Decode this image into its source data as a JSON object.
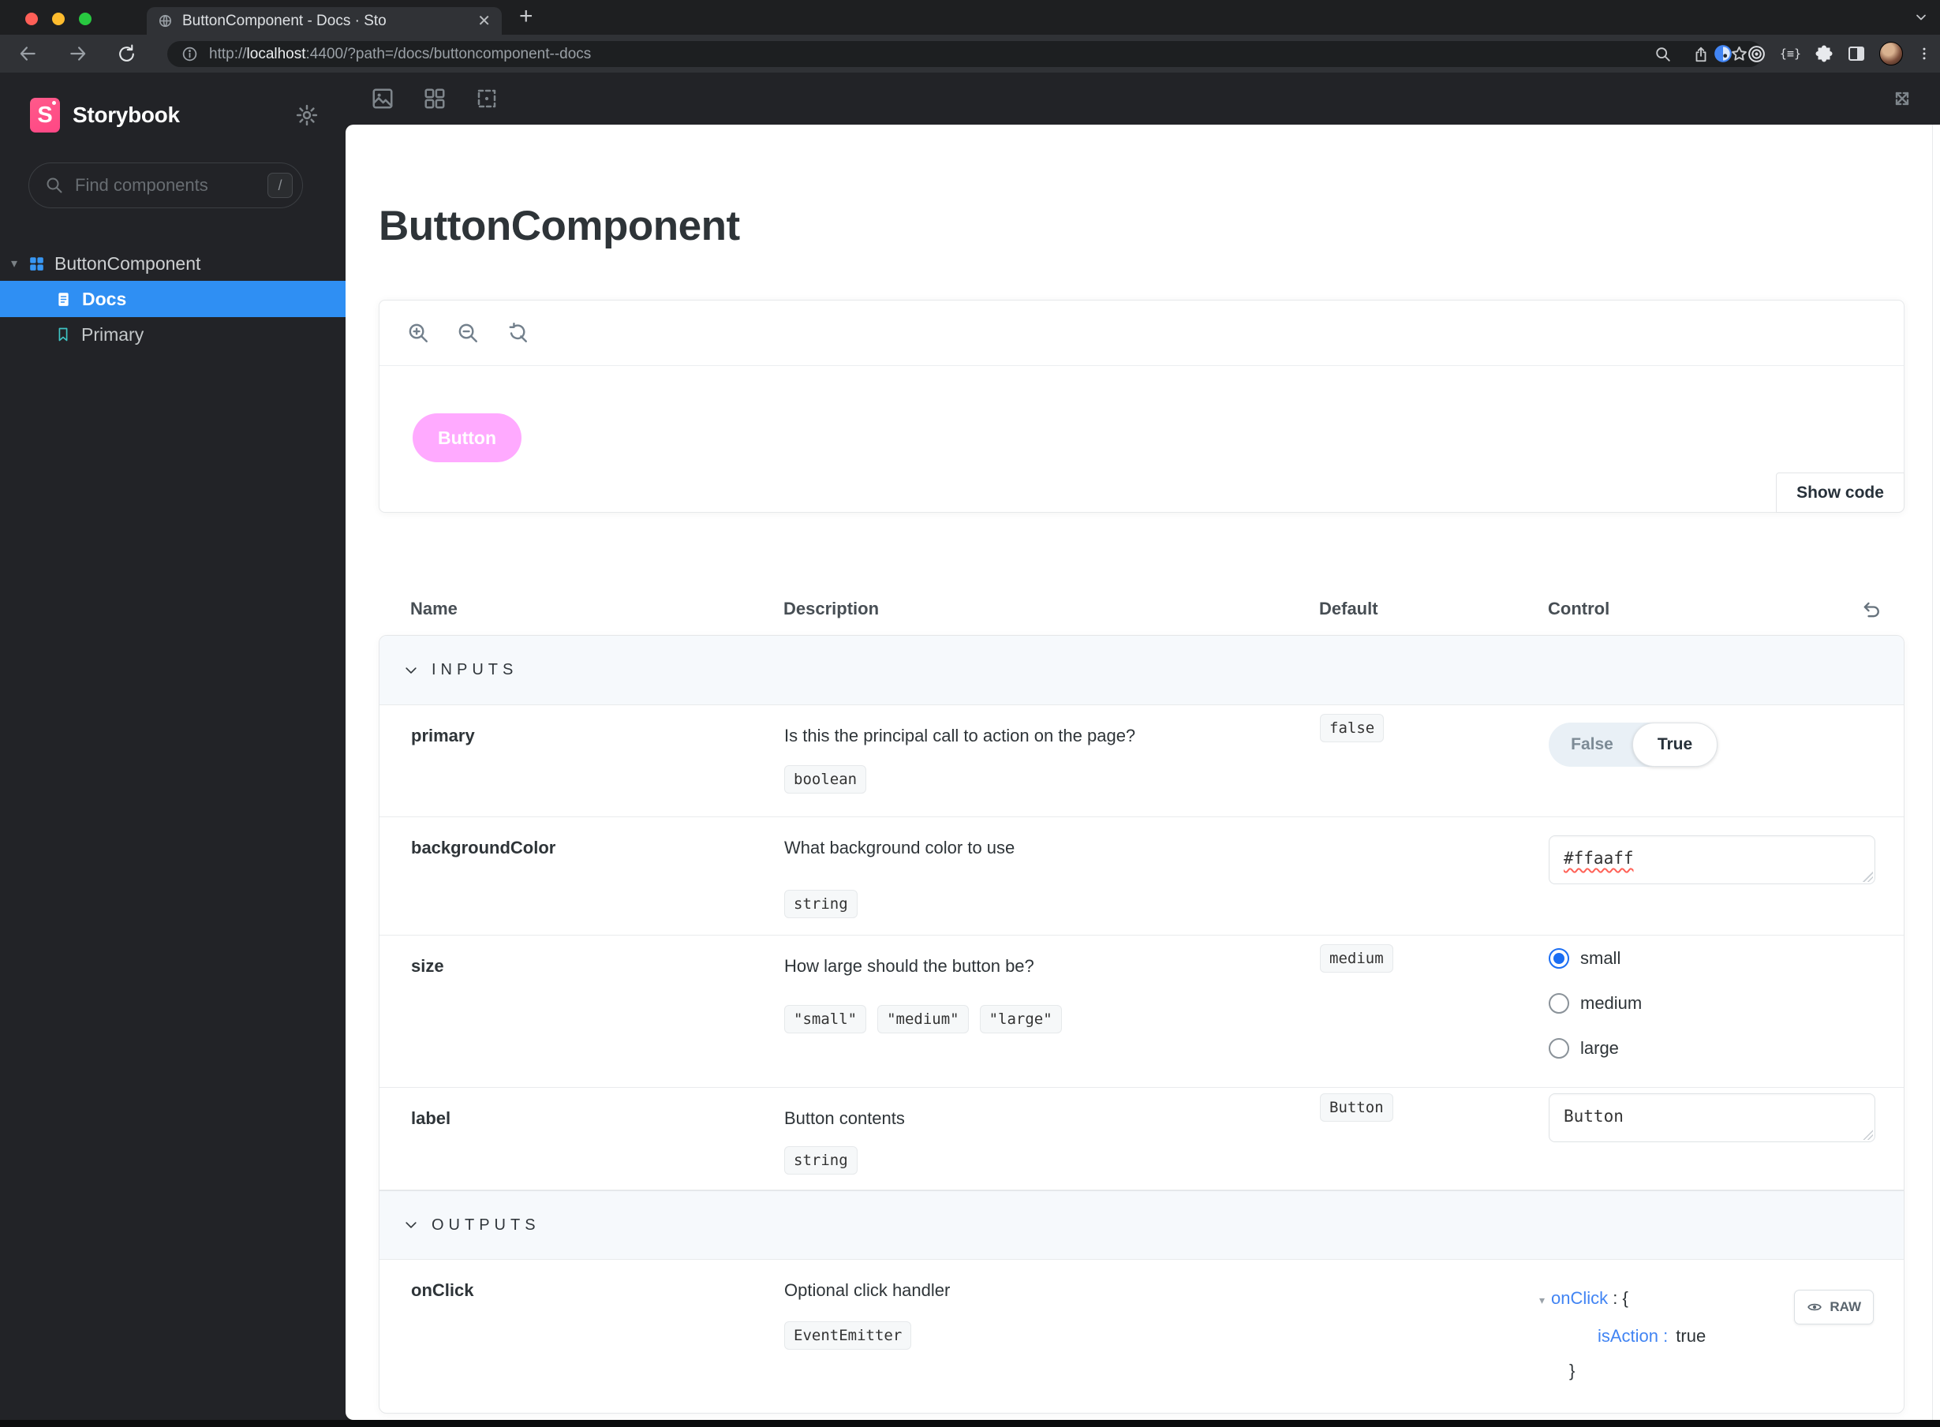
{
  "colors": {
    "accent": "#2f8ff3",
    "brand": "#ff4785",
    "button-bg": "#ffaaff",
    "link-blue": "#4184f3",
    "radio-blue": "#1b6ef3",
    "bookmark-teal": "#3fc4c4",
    "component-blue": "#3897f4"
  },
  "browser": {
    "tab": {
      "title": "ButtonComponent - Docs · Sto",
      "close_glyph": "✕",
      "new_tab_glyph": "+"
    },
    "url": {
      "protocol": "http://",
      "host": "localhost",
      "rest": ":4400/?path=/docs/buttoncomponent--docs"
    }
  },
  "manager": {
    "brand": "Storybook",
    "logo_letter": "S",
    "search": {
      "placeholder": "Find components",
      "shortcut": "/"
    },
    "tree": {
      "root": "ButtonComponent",
      "root_caret": "▾",
      "docs": "Docs",
      "primary": "Primary"
    }
  },
  "docs": {
    "title": "ButtonComponent",
    "preview": {
      "button_label": "Button",
      "show_code": "Show code"
    },
    "table": {
      "headers": {
        "name": "Name",
        "description": "Description",
        "default": "Default",
        "control": "Control"
      },
      "sections": {
        "inputs": "INPUTS",
        "outputs": "OUTPUTS"
      },
      "rows": {
        "primary": {
          "name": "primary",
          "description": "Is this the principal call to action on the page?",
          "type": "boolean",
          "default": "false",
          "toggle": {
            "false_label": "False",
            "true_label": "True"
          }
        },
        "backgroundColor": {
          "name": "backgroundColor",
          "description": "What background color to use",
          "type": "string",
          "value": "#ffaaff"
        },
        "size": {
          "name": "size",
          "description": "How large should the button be?",
          "type_chips": [
            "\"small\"",
            "\"medium\"",
            "\"large\""
          ],
          "default": "medium",
          "options": [
            "small",
            "medium",
            "large"
          ],
          "selected": "small"
        },
        "label": {
          "name": "label",
          "description": "Button contents",
          "type": "string",
          "default": "Button",
          "value": "Button"
        },
        "onClick": {
          "name": "onClick",
          "description": "Optional click handler",
          "type": "EventEmitter",
          "object": {
            "caret": "▾",
            "key": "onClick",
            "open": " : {",
            "prop_key": "isAction :",
            "prop_value": "true",
            "close": "}"
          },
          "raw": "RAW"
        }
      }
    }
  }
}
